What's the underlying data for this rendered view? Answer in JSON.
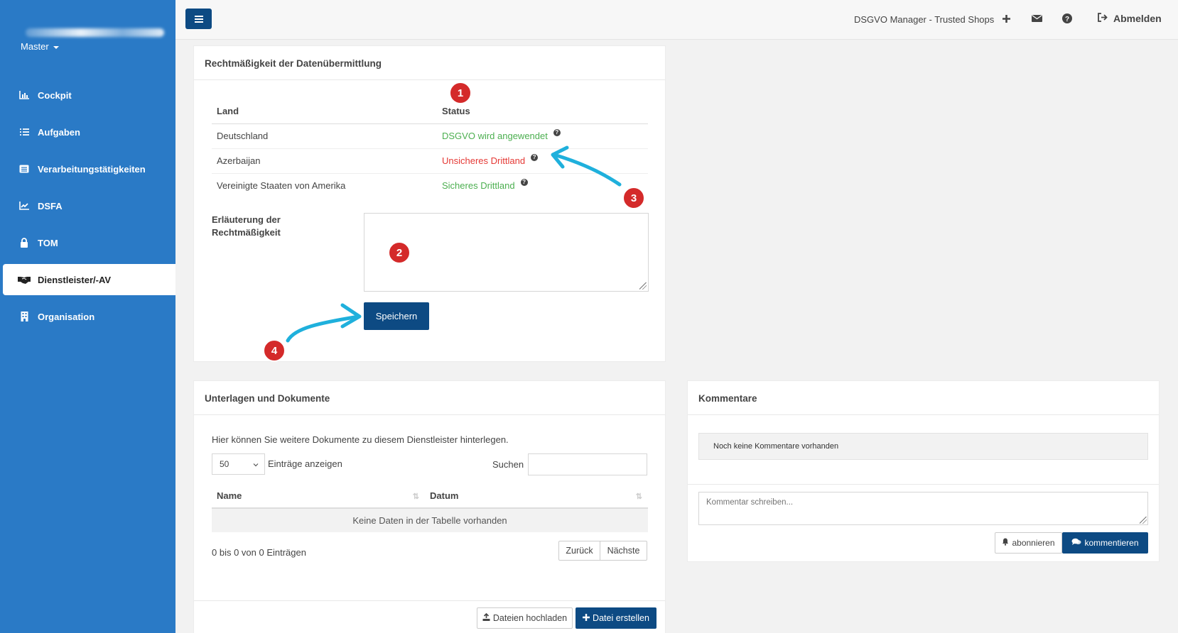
{
  "sidebar": {
    "master_label": "Master",
    "items": [
      {
        "label": "Cockpit",
        "icon": "chart-bar-icon"
      },
      {
        "label": "Aufgaben",
        "icon": "list-icon"
      },
      {
        "label": "Verarbeitungstätigkeiten",
        "icon": "table-list-icon"
      },
      {
        "label": "DSFA",
        "icon": "chart-line-icon"
      },
      {
        "label": "TOM",
        "icon": "lock-icon"
      },
      {
        "label": "Dienstleister/-AV",
        "icon": "handshake-icon",
        "active": true
      },
      {
        "label": "Organisation",
        "icon": "building-icon"
      }
    ]
  },
  "topbar": {
    "title": "DSGVO Manager - Trusted Shops",
    "logout_label": "Abmelden"
  },
  "legal_panel": {
    "title": "Rechtmäßigkeit der Datenübermittlung",
    "col_country": "Land",
    "col_status": "Status",
    "rows": [
      {
        "country": "Deutschland",
        "status": "DSGVO wird angewendet",
        "status_color": "#4caf50"
      },
      {
        "country": "Azerbaijan",
        "status": "Unsicheres Drittland",
        "status_color": "#e53935"
      },
      {
        "country": "Vereinigte Staaten von Amerika",
        "status": "Sicheres Drittland",
        "status_color": "#4caf50"
      }
    ],
    "explanation_label_1": "Erläuterung der",
    "explanation_label_2": "Rechtmäßigkeit",
    "explanation_value": "",
    "save_label": "Speichern"
  },
  "annotations": [
    "1",
    "2",
    "3",
    "4"
  ],
  "documents_panel": {
    "title": "Unterlagen und Dokumente",
    "description": "Hier können Sie weitere Dokumente zu diesem Dienstleister hinterlegen.",
    "page_size": "50",
    "entries_label": "Einträge anzeigen",
    "search_label": "Suchen",
    "col_name": "Name",
    "col_date": "Datum",
    "empty_text": "Keine Daten in der Tabelle vorhanden",
    "info_text": "0 bis 0 von 0 Einträgen",
    "prev_label": "Zurück",
    "next_label": "Nächste",
    "upload_label": "Dateien hochladen",
    "create_label": "Datei erstellen"
  },
  "comments_panel": {
    "title": "Kommentare",
    "empty_text": "Noch keine Kommentare vorhanden",
    "input_placeholder": "Kommentar schreiben...",
    "subscribe_label": "abonnieren",
    "comment_label": "kommentieren"
  },
  "colors": {
    "sidebar": "#2a7ac6",
    "primary": "#0d4a83",
    "success": "#4caf50",
    "danger": "#e53935",
    "badge": "#d42a2a",
    "arrow": "#1fb0dc"
  }
}
